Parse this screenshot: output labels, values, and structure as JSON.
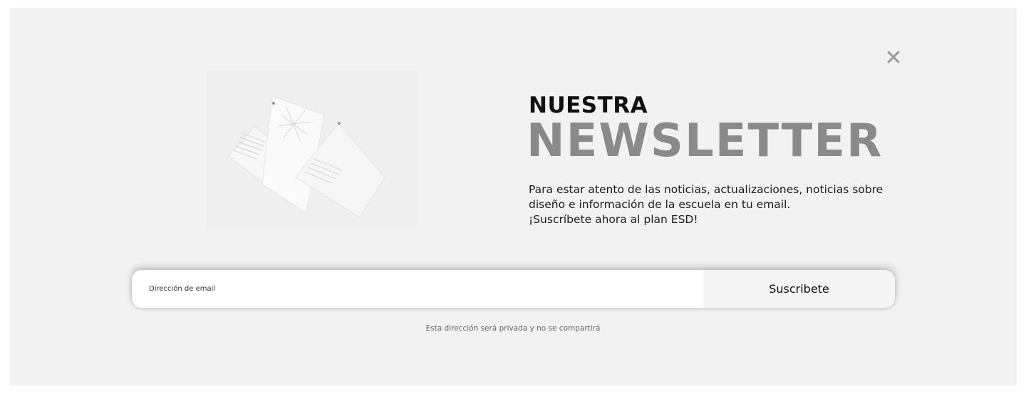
{
  "modal": {
    "close_icon": "close-icon"
  },
  "heading": {
    "line1": "NUESTRA",
    "line2": "NEWSLETTER"
  },
  "description": {
    "line1": "Para estar atento de las noticias, actualizaciones, noticias sobre",
    "line2": "diseño e información de la escuela en tu email.",
    "line3": "¡Suscríbete ahora al plan ESD!"
  },
  "form": {
    "email_placeholder": "Dirección de email",
    "email_value": "",
    "submit_label": "Suscribete"
  },
  "privacy_note": "Esta dirección será privada y no se compartirá",
  "colors": {
    "panel_bg": "#f2f2f2",
    "heading_dark": "#111111",
    "heading_gray": "#8a8a8a"
  }
}
